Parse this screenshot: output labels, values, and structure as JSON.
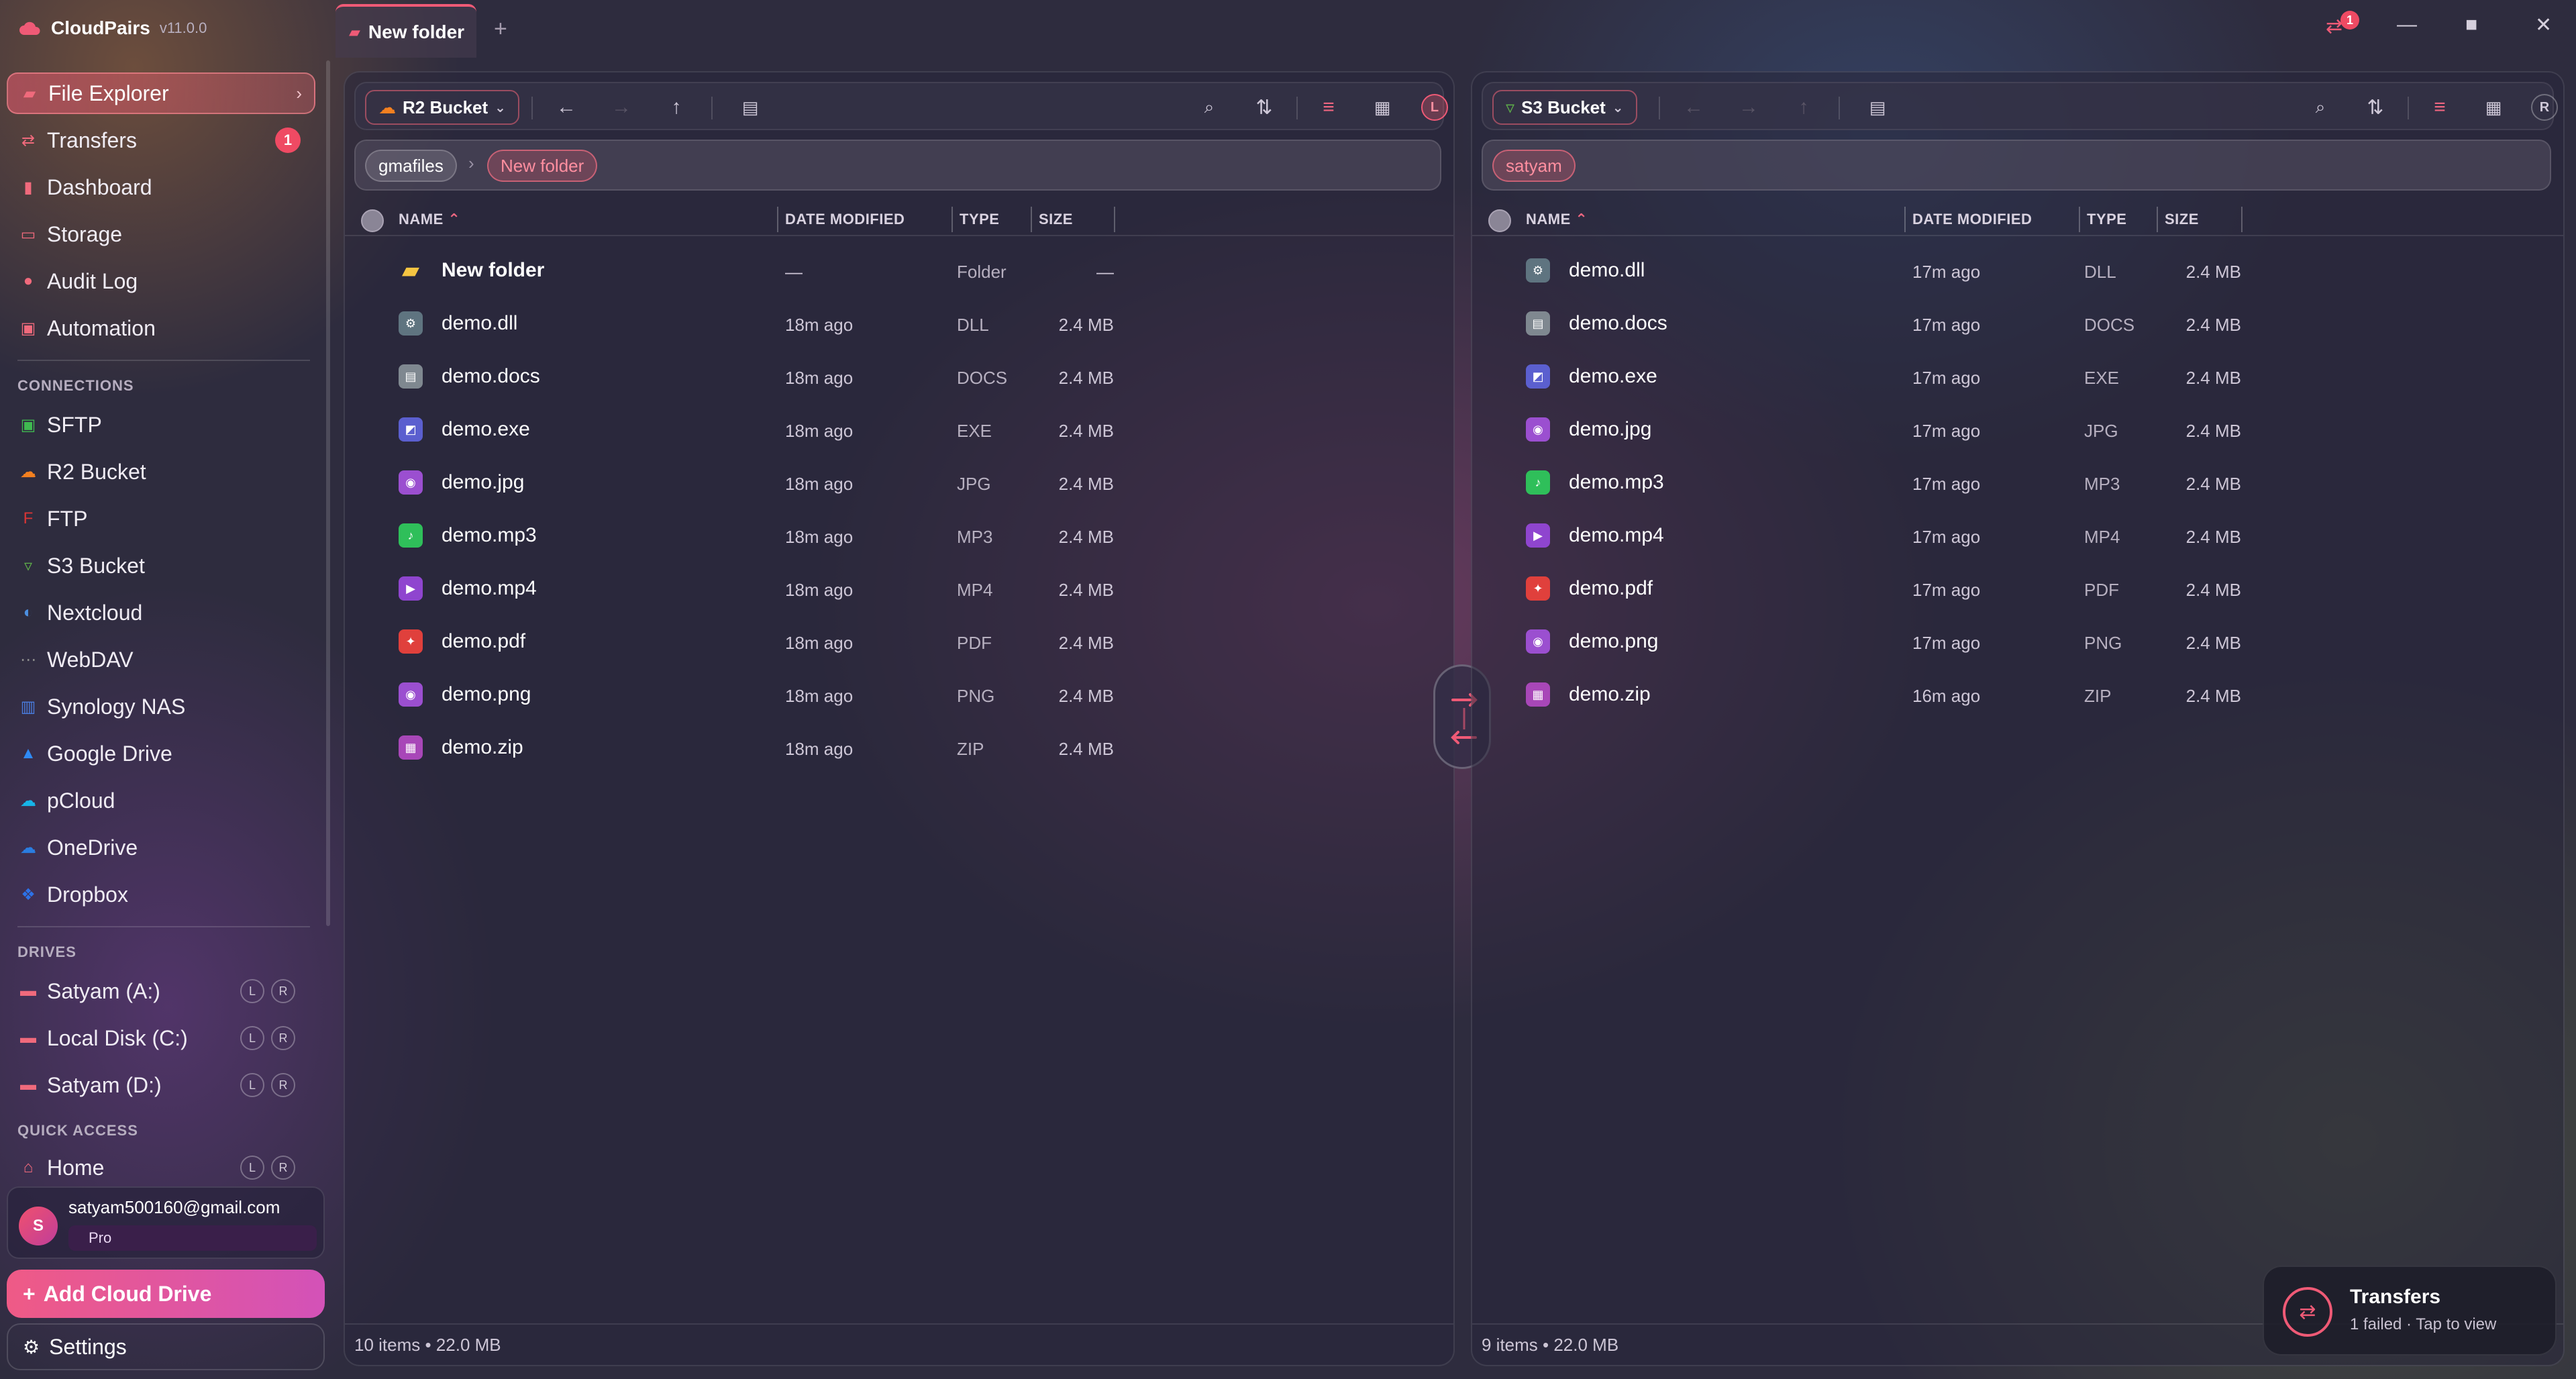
{
  "app": {
    "name": "CloudPairs",
    "version": "v11.0.0"
  },
  "tabs": [
    {
      "label": "New folder"
    }
  ],
  "titlebar": {
    "transfer_badge": "1"
  },
  "sidebar": {
    "nav": [
      {
        "label": "File Explorer",
        "icon": "folder-icon"
      },
      {
        "label": "Transfers",
        "icon": "transfer-icon",
        "badge": "1"
      },
      {
        "label": "Dashboard",
        "icon": "bar-chart-icon"
      },
      {
        "label": "Storage",
        "icon": "storage-icon"
      },
      {
        "label": "Audit Log",
        "icon": "clock-icon"
      },
      {
        "label": "Automation",
        "icon": "automation-icon"
      }
    ],
    "connections_label": "CONNECTIONS",
    "connections": [
      {
        "label": "SFTP",
        "icon": "sftp-icon",
        "color": "#3fb950"
      },
      {
        "label": "R2 Bucket",
        "icon": "cloudflare-icon",
        "color": "#f38020"
      },
      {
        "label": "FTP",
        "icon": "ftp-icon",
        "color": "#d93535"
      },
      {
        "label": "S3 Bucket",
        "icon": "bucket-icon",
        "color": "#5fb04a"
      },
      {
        "label": "Nextcloud",
        "icon": "nextcloud-icon",
        "color": "#4c8fe0"
      },
      {
        "label": "WebDAV",
        "icon": "webdav-icon",
        "color": "#8a8a8a"
      },
      {
        "label": "Synology NAS",
        "icon": "synology-icon",
        "color": "#4a7de0"
      },
      {
        "label": "Google Drive",
        "icon": "google-drive-icon",
        "color": "#2f8af5"
      },
      {
        "label": "pCloud",
        "icon": "pcloud-icon",
        "color": "#17b5e8"
      },
      {
        "label": "OneDrive",
        "icon": "onedrive-icon",
        "color": "#2a7de0"
      },
      {
        "label": "Dropbox",
        "icon": "dropbox-icon",
        "color": "#2d72e8"
      }
    ],
    "drives_label": "DRIVES",
    "drives": [
      {
        "label": "Satyam (A:)"
      },
      {
        "label": "Local Disk (C:)"
      },
      {
        "label": "Satyam (D:)"
      }
    ],
    "quick_label": "QUICK ACCESS",
    "quick": [
      {
        "label": "Home"
      }
    ],
    "lr": {
      "l": "L",
      "r": "R"
    },
    "user": {
      "initial": "S",
      "email": "satyam500160@gmail.com",
      "plan": "Pro"
    },
    "add_drive": "Add Cloud Drive",
    "settings": "Settings"
  },
  "columns": {
    "name": "NAME",
    "date": "DATE MODIFIED",
    "type": "TYPE",
    "size": "SIZE"
  },
  "left_pane": {
    "source": "R2 Bucket",
    "side": "L",
    "breadcrumb": [
      "gmafiles",
      "New folder"
    ],
    "files": [
      {
        "name": "New folder",
        "date": "—",
        "type": "Folder",
        "size": "—",
        "icon": "folder-icon",
        "color": "#f5c542"
      },
      {
        "name": "demo.dll",
        "date": "18m ago",
        "type": "DLL",
        "size": "2.4 MB",
        "icon": "gear-icon",
        "color": "#5f7480"
      },
      {
        "name": "demo.docs",
        "date": "18m ago",
        "type": "DOCS",
        "size": "2.4 MB",
        "icon": "document-icon",
        "color": "#7f8890"
      },
      {
        "name": "demo.exe",
        "date": "18m ago",
        "type": "EXE",
        "size": "2.4 MB",
        "icon": "app-icon",
        "color": "#5b5fcf"
      },
      {
        "name": "demo.jpg",
        "date": "18m ago",
        "type": "JPG",
        "size": "2.4 MB",
        "icon": "image-icon",
        "color": "#9b4fd0"
      },
      {
        "name": "demo.mp3",
        "date": "18m ago",
        "type": "MP3",
        "size": "2.4 MB",
        "icon": "music-icon",
        "color": "#2fbf5a"
      },
      {
        "name": "demo.mp4",
        "date": "18m ago",
        "type": "MP4",
        "size": "2.4 MB",
        "icon": "video-icon",
        "color": "#8f45cf"
      },
      {
        "name": "demo.pdf",
        "date": "18m ago",
        "type": "PDF",
        "size": "2.4 MB",
        "icon": "pdf-icon",
        "color": "#e0403c"
      },
      {
        "name": "demo.png",
        "date": "18m ago",
        "type": "PNG",
        "size": "2.4 MB",
        "icon": "image-icon",
        "color": "#9b4fd0"
      },
      {
        "name": "demo.zip",
        "date": "18m ago",
        "type": "ZIP",
        "size": "2.4 MB",
        "icon": "archive-icon",
        "color": "#a847b8"
      }
    ],
    "status": "10 items • 22.0 MB"
  },
  "right_pane": {
    "source": "S3 Bucket",
    "side": "R",
    "breadcrumb": [
      "satyam"
    ],
    "files": [
      {
        "name": "demo.dll",
        "date": "17m ago",
        "type": "DLL",
        "size": "2.4 MB",
        "icon": "gear-icon",
        "color": "#5f7480"
      },
      {
        "name": "demo.docs",
        "date": "17m ago",
        "type": "DOCS",
        "size": "2.4 MB",
        "icon": "document-icon",
        "color": "#7f8890"
      },
      {
        "name": "demo.exe",
        "date": "17m ago",
        "type": "EXE",
        "size": "2.4 MB",
        "icon": "app-icon",
        "color": "#5b5fcf"
      },
      {
        "name": "demo.jpg",
        "date": "17m ago",
        "type": "JPG",
        "size": "2.4 MB",
        "icon": "image-icon",
        "color": "#9b4fd0"
      },
      {
        "name": "demo.mp3",
        "date": "17m ago",
        "type": "MP3",
        "size": "2.4 MB",
        "icon": "music-icon",
        "color": "#2fbf5a"
      },
      {
        "name": "demo.mp4",
        "date": "17m ago",
        "type": "MP4",
        "size": "2.4 MB",
        "icon": "video-icon",
        "color": "#8f45cf"
      },
      {
        "name": "demo.pdf",
        "date": "17m ago",
        "type": "PDF",
        "size": "2.4 MB",
        "icon": "pdf-icon",
        "color": "#e0403c"
      },
      {
        "name": "demo.png",
        "date": "17m ago",
        "type": "PNG",
        "size": "2.4 MB",
        "icon": "image-icon",
        "color": "#9b4fd0"
      },
      {
        "name": "demo.zip",
        "date": "16m ago",
        "type": "ZIP",
        "size": "2.4 MB",
        "icon": "archive-icon",
        "color": "#a847b8"
      }
    ],
    "status": "9 items • 22.0 MB"
  },
  "toast": {
    "title": "Transfers",
    "subtitle": "1 failed · Tap to view"
  },
  "colors": {
    "accent": "#ef5a76",
    "background": "#2e2c3e"
  }
}
